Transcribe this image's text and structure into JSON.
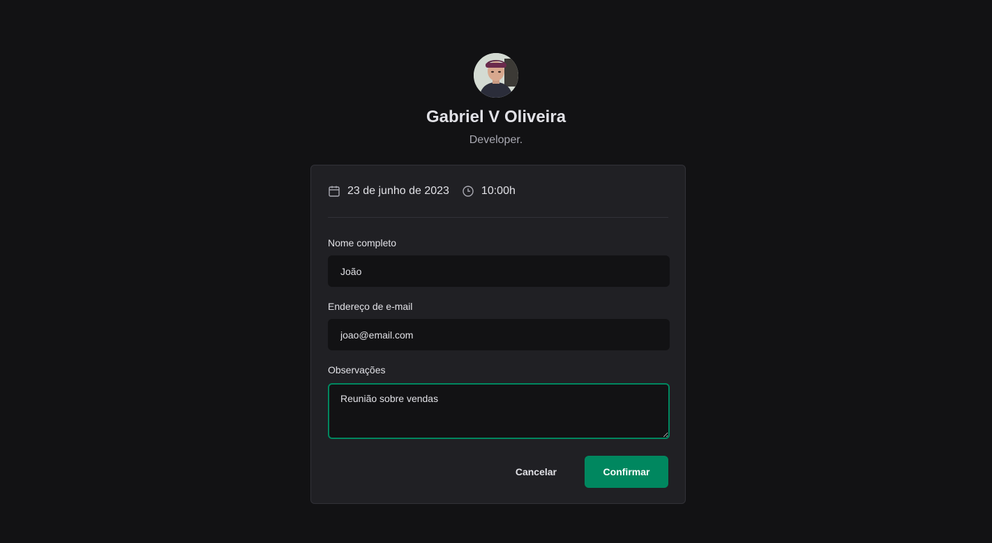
{
  "profile": {
    "name": "Gabriel V Oliveira",
    "bio": "Developer."
  },
  "schedule": {
    "date": "23 de junho de 2023",
    "time": "10:00h",
    "date_icon": "calendar-icon",
    "time_icon": "clock-icon"
  },
  "form": {
    "name_label": "Nome completo",
    "name_value": "João",
    "email_label": "Endereço de e-mail",
    "email_value": "joao@email.com",
    "notes_label": "Observações",
    "notes_value": "Reunião sobre vendas"
  },
  "actions": {
    "cancel_label": "Cancelar",
    "confirm_label": "Confirmar"
  },
  "colors": {
    "background": "#121214",
    "card": "#202024",
    "accent": "#00875f"
  }
}
